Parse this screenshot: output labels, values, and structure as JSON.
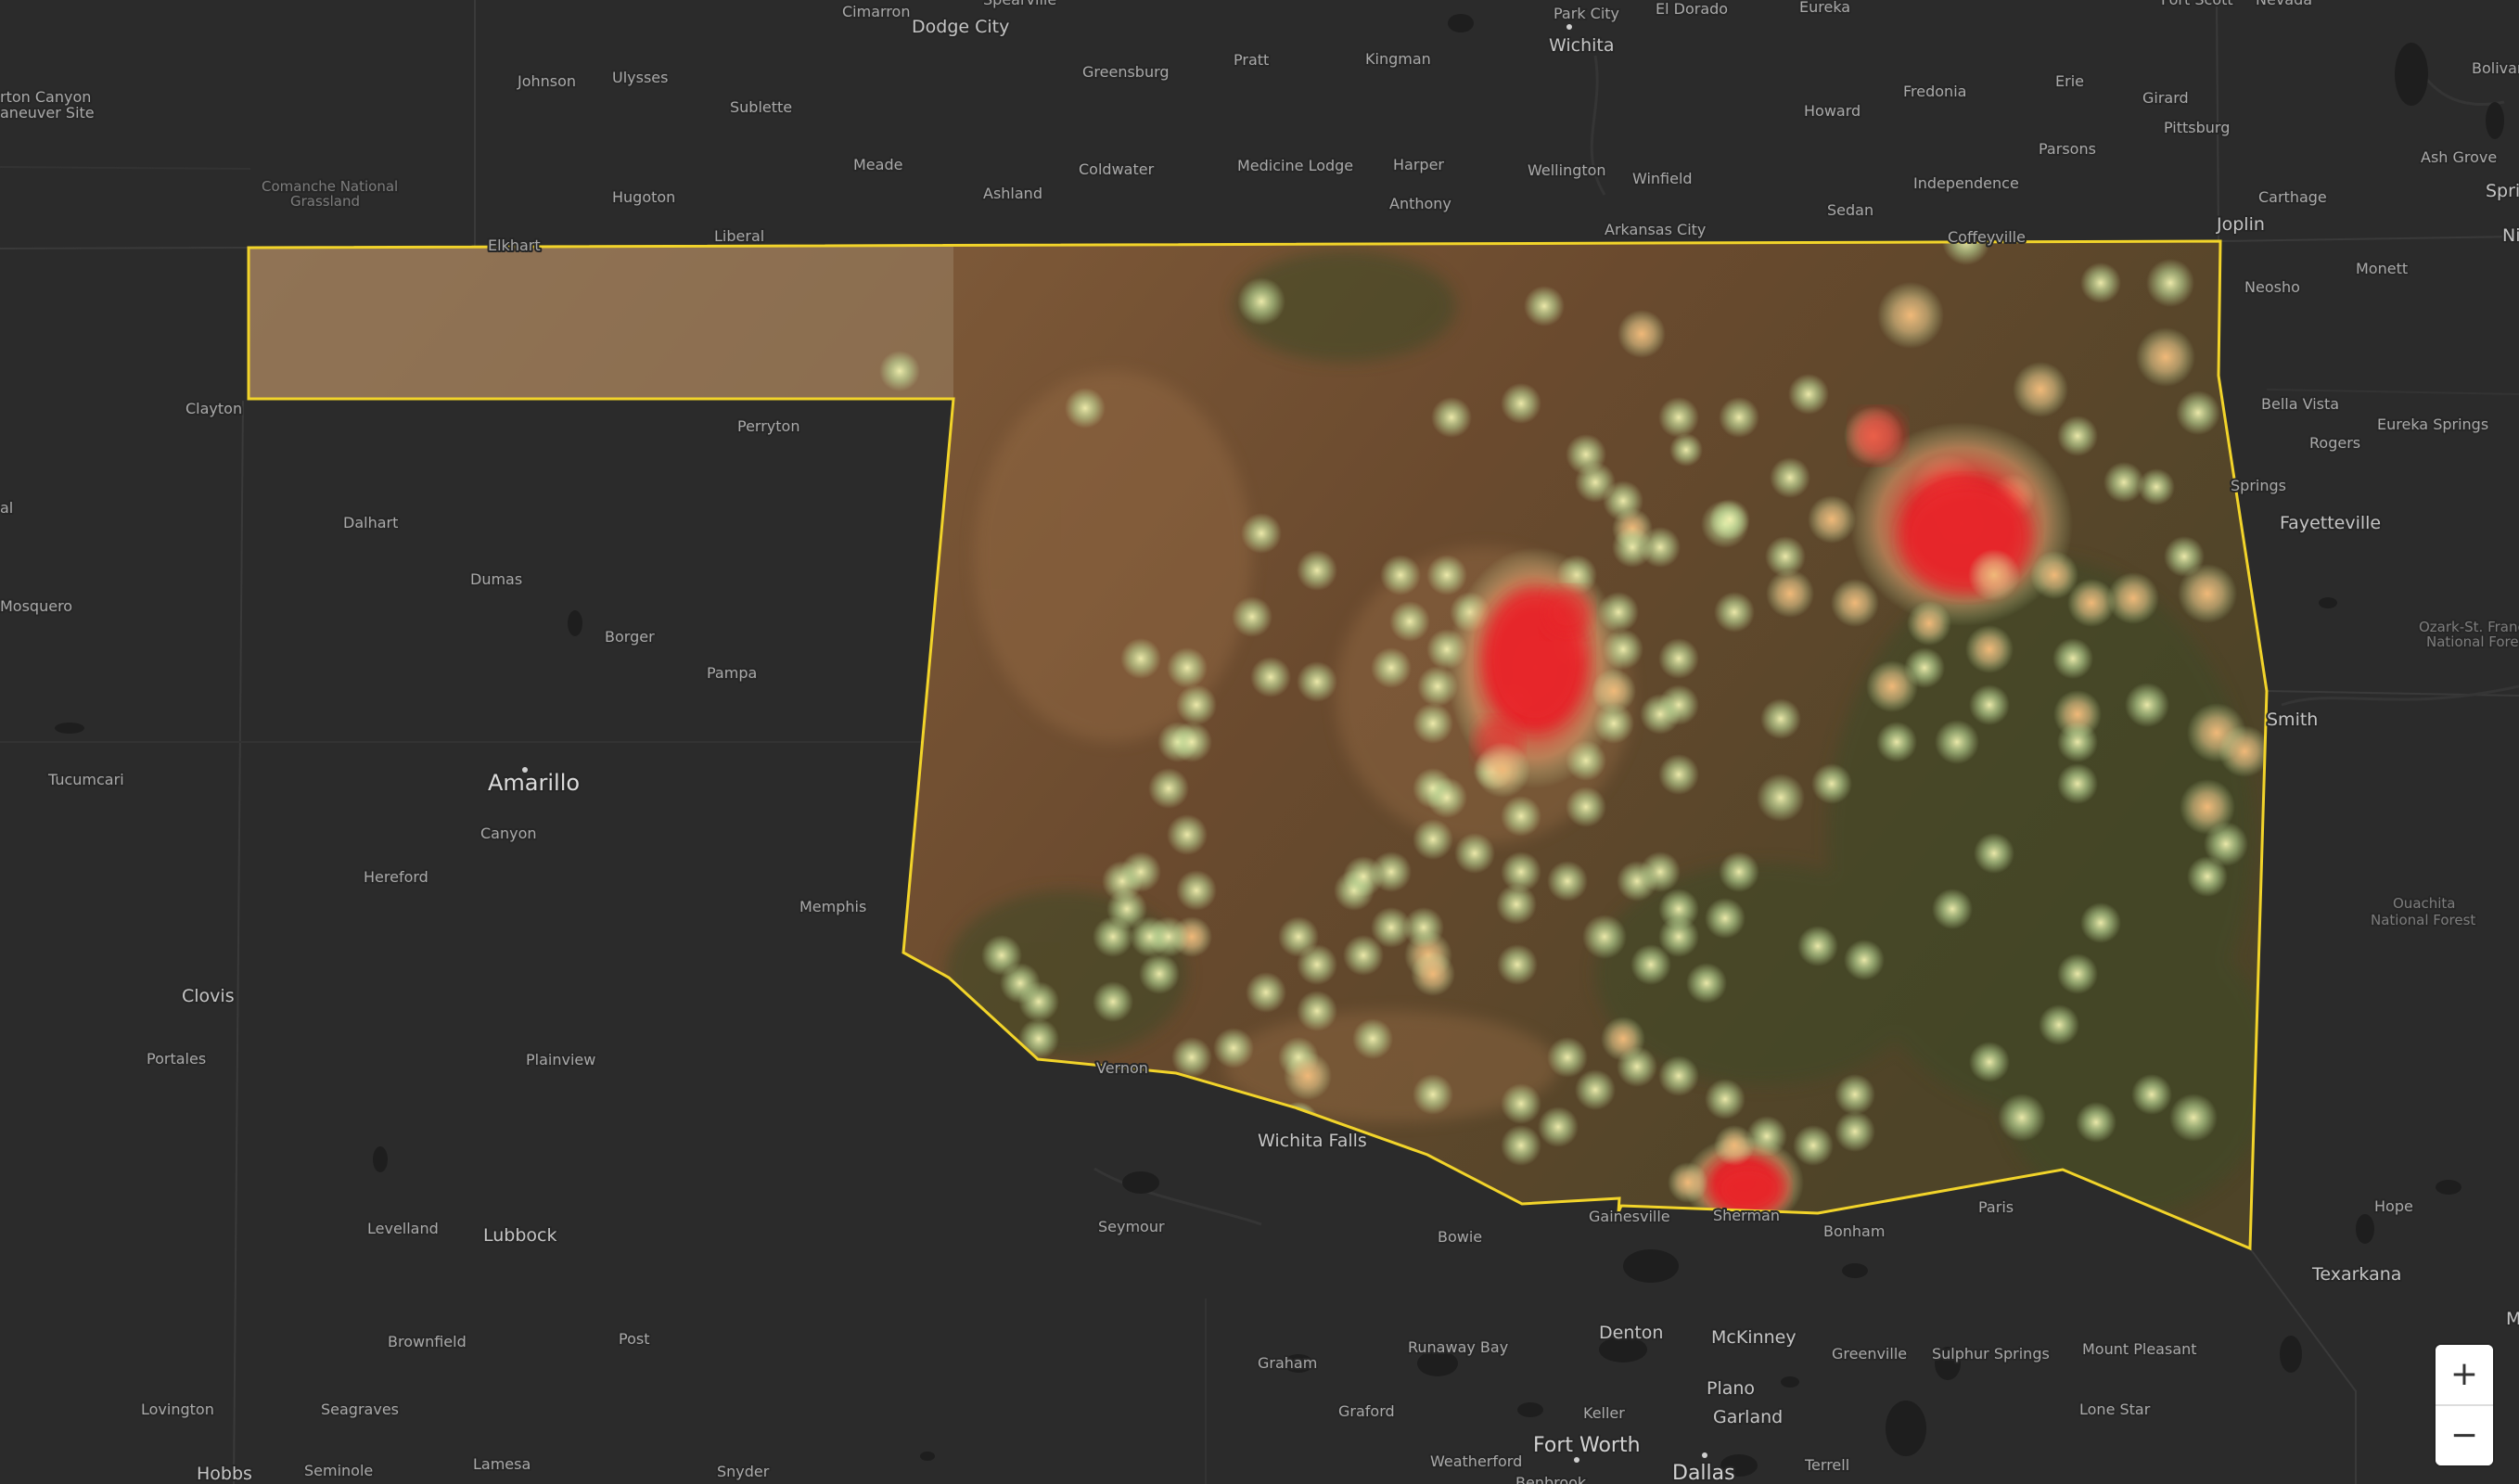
{
  "map": {
    "theme": {
      "background": "#2b2b2b",
      "state_outline": "#f2d42a",
      "terrain_base": "#6b4a2e",
      "heat_low": "#c8e6a0",
      "heat_mid": "#f0b878",
      "heat_high": "#e8262a"
    },
    "labels": {
      "cimarron": "Cimarron",
      "dodge_city": "Dodge City",
      "spearville": "Spearville",
      "park_city": "Park City",
      "el_dorado": "El Dorado",
      "eureka": "Eureka",
      "fort_scott": "Fort Scott",
      "nevada": "Nevada",
      "wichita": "Wichita",
      "morton": "rton Canyon",
      "morton2": "aneuver Site",
      "johnson": "Johnson",
      "ulysses": "Ulysses",
      "greensburg": "Greensburg",
      "pratt": "Pratt",
      "kingman": "Kingman",
      "bolivar": "Bolivar",
      "sublette": "Sublette",
      "howard": "Howard",
      "fredonia": "Fredonia",
      "erie": "Erie",
      "girard": "Girard",
      "pittsburg": "Pittsburg",
      "ash_grove": "Ash Grove",
      "meade": "Meade",
      "coldwater": "Coldwater",
      "medicine_lodge": "Medicine Lodge",
      "harper": "Harper",
      "wellington": "Wellington",
      "winfield": "Winfield",
      "parsons": "Parsons",
      "independence": "Independence",
      "comanche1": "Comanche National",
      "comanche2": "Grassland",
      "ashland": "Ashland",
      "hugoton": "Hugoton",
      "anthony": "Anthony",
      "carthage": "Carthage",
      "springfield_edge": "Spri",
      "sedan": "Sedan",
      "joplin": "Joplin",
      "liberal": "Liberal",
      "elkhart": "Elkhart",
      "arkansas_city": "Arkansas City",
      "coffeyville": "Coffeyville",
      "nixa_edge": "Ni",
      "neosho": "Neosho",
      "monett": "Monett",
      "clayton": "Clayton",
      "perryton": "Perryton",
      "bella_vista": "Bella Vista",
      "rogers": "Rogers",
      "eureka_springs": "Eureka Springs",
      "springdale": "Springs",
      "fayetteville": "Fayetteville",
      "dalhart": "Dalhart",
      "dumas": "Dumas",
      "mosquero": "Mosquero",
      "mtn_edge": "al",
      "borger": "Borger",
      "ozark1": "Ozark-St. Franc",
      "ozark2": "National Fores",
      "pampa": "Pampa",
      "fort_smith": "Smith",
      "tucumcari": "Tucumcari",
      "amarillo": "Amarillo",
      "canyon": "Canyon",
      "hereford": "Hereford",
      "memphis": "Memphis",
      "ouachita1": "Ouachita",
      "ouachita2": "National Forest",
      "clovis": "Clovis",
      "portales": "Portales",
      "plainview": "Plainview",
      "vernon": "Vernon",
      "wichita_falls": "Wichita Falls",
      "hope": "Hope",
      "gainesville": "Gainesville",
      "sherman": "Sherman",
      "bonham": "Bonham",
      "paris": "Paris",
      "levelland": "Levelland",
      "lubbock": "Lubbock",
      "seymour": "Seymour",
      "bowie": "Bowie",
      "texarkana": "Texarkana",
      "denton": "Denton",
      "mckinney": "McKinney",
      "brownfield": "Brownfield",
      "post": "Post",
      "runaway_bay": "Runaway Bay",
      "greenville": "Greenville",
      "sulphur_springs": "Sulphur Springs",
      "mount_pleasant": "Mount Pleasant",
      "graham": "Graham",
      "plano": "Plano",
      "lovington": "Lovington",
      "seagraves": "Seagraves",
      "graford": "Graford",
      "garland": "Garland",
      "lone_star": "Lone Star",
      "keller": "Keller",
      "fort_worth": "Fort Worth",
      "ma_edge": "M",
      "weatherford": "Weatherford",
      "terrell": "Terrell",
      "hobbs": "Hobbs",
      "seminole": "Seminole",
      "lamesa": "Lamesa",
      "snyder": "Snyder",
      "dallas": "Dallas",
      "benbrook": "Benbrook"
    }
  },
  "controls": {
    "zoom_in": "+",
    "zoom_out": "−"
  }
}
